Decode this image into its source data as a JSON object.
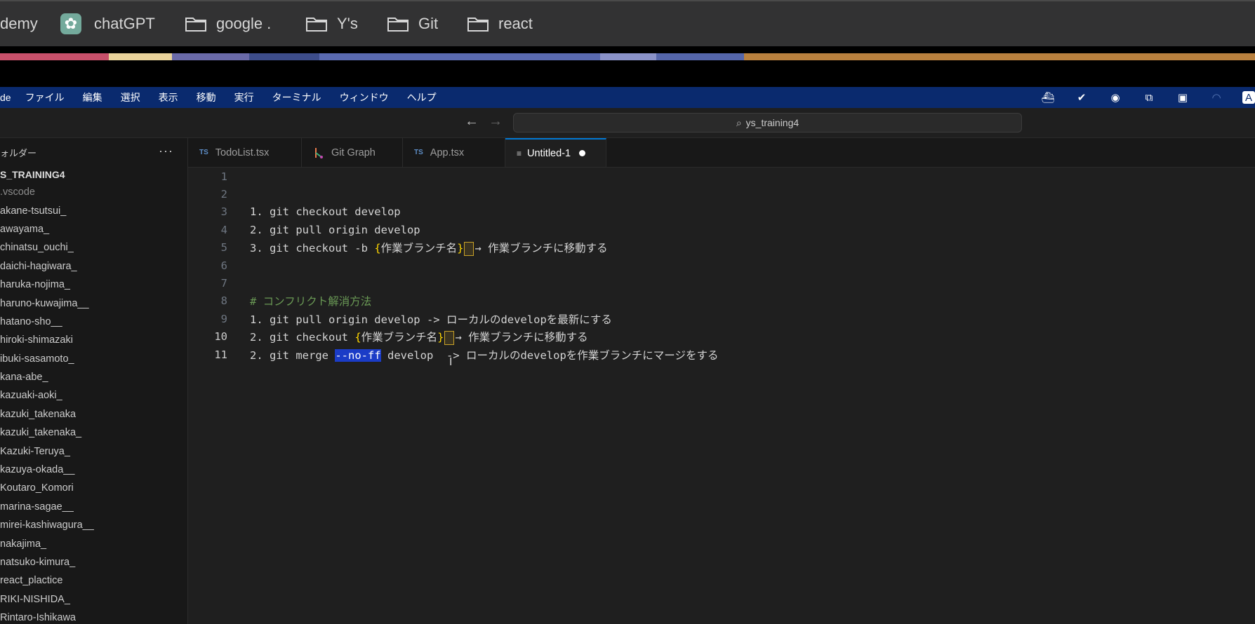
{
  "bookmarks": [
    {
      "label": "demy",
      "icon": "none"
    },
    {
      "label": "chatGPT",
      "icon": "chatgpt-icon"
    },
    {
      "label": "google .",
      "icon": "folder-icon"
    },
    {
      "label": "Y's",
      "icon": "folder-icon"
    },
    {
      "label": "Git",
      "icon": "folder-icon"
    },
    {
      "label": "react",
      "icon": "folder-icon"
    }
  ],
  "menubar": {
    "app": "de",
    "items": [
      "ファイル",
      "編集",
      "選択",
      "表示",
      "移動",
      "実行",
      "ターミナル",
      "ウィンドウ",
      "ヘルプ"
    ],
    "right_icons": [
      "docker-icon",
      "check-circle-icon",
      "record-icon",
      "screens-icon",
      "grid-icon",
      "wifi-icon",
      "text-a-icon"
    ],
    "right_last": "A"
  },
  "titlebar": {
    "search": "ys_training4"
  },
  "sidebar": {
    "header": "ォルダー",
    "more": "···",
    "project": "S_TRAINING4",
    "items": [
      ".vscode",
      "akane-tsutsui_",
      "awayama_",
      "chinatsu_ouchi_",
      "daichi-hagiwara_",
      "haruka-nojima_",
      "haruno-kuwajima__",
      "hatano-sho__",
      "hiroki-shimazaki",
      "ibuki-sasamoto_",
      "kana-abe_",
      "kazuaki-aoki_",
      "kazuki_takenaka",
      "kazuki_takenaka_",
      "Kazuki-Teruya_",
      "kazuya-okada__",
      "Koutaro_Komori",
      "marina-sagae__",
      "mirei-kashiwagura__",
      "nakajima_",
      "natsuko-kimura_",
      "react_plactice",
      "RIKI-NISHIDA_",
      "Rintaro-Ishikawa"
    ]
  },
  "tabs": [
    {
      "label": "TodoList.tsx",
      "prefix": "TS",
      "active": false
    },
    {
      "label": "Git Graph",
      "prefix": "",
      "active": false
    },
    {
      "label": "App.tsx",
      "prefix": "TS",
      "active": false
    },
    {
      "label": "Untitled-1",
      "prefix": "",
      "active": true
    }
  ],
  "editor": {
    "line_numbers": [
      "1",
      "2",
      "3",
      "4",
      "5",
      "6",
      "7",
      "8",
      "9",
      "10",
      "11"
    ],
    "l3": "1. git checkout develop",
    "l4": "2. git pull origin develop",
    "l5_a": "3. git checkout -b ",
    "l5_b": "{",
    "l5_c": "作業ブランチ名",
    "l5_d": "}",
    "l5_e": "→ 作業ブランチに移動する",
    "l8": "# コンフリクト解消方法",
    "l9": "1. git pull origin develop -> ローカルのdevelopを最新にする",
    "l10_a": "2. git checkout ",
    "l10_b": "{",
    "l10_c": "作業ブランチ名",
    "l10_d": "}",
    "l10_e": "→ 作業ブランチに移動する",
    "l11_a": "2. git merge ",
    "l11_b": "--no-ff",
    "l11_c": " develop  -> ローカルのdevelopを作業ブランチにマージをする"
  },
  "colors": {
    "menubar": "#0a2a6e",
    "accent": "#0078d4",
    "brace": "#ffd700",
    "comment": "#6a9955"
  }
}
